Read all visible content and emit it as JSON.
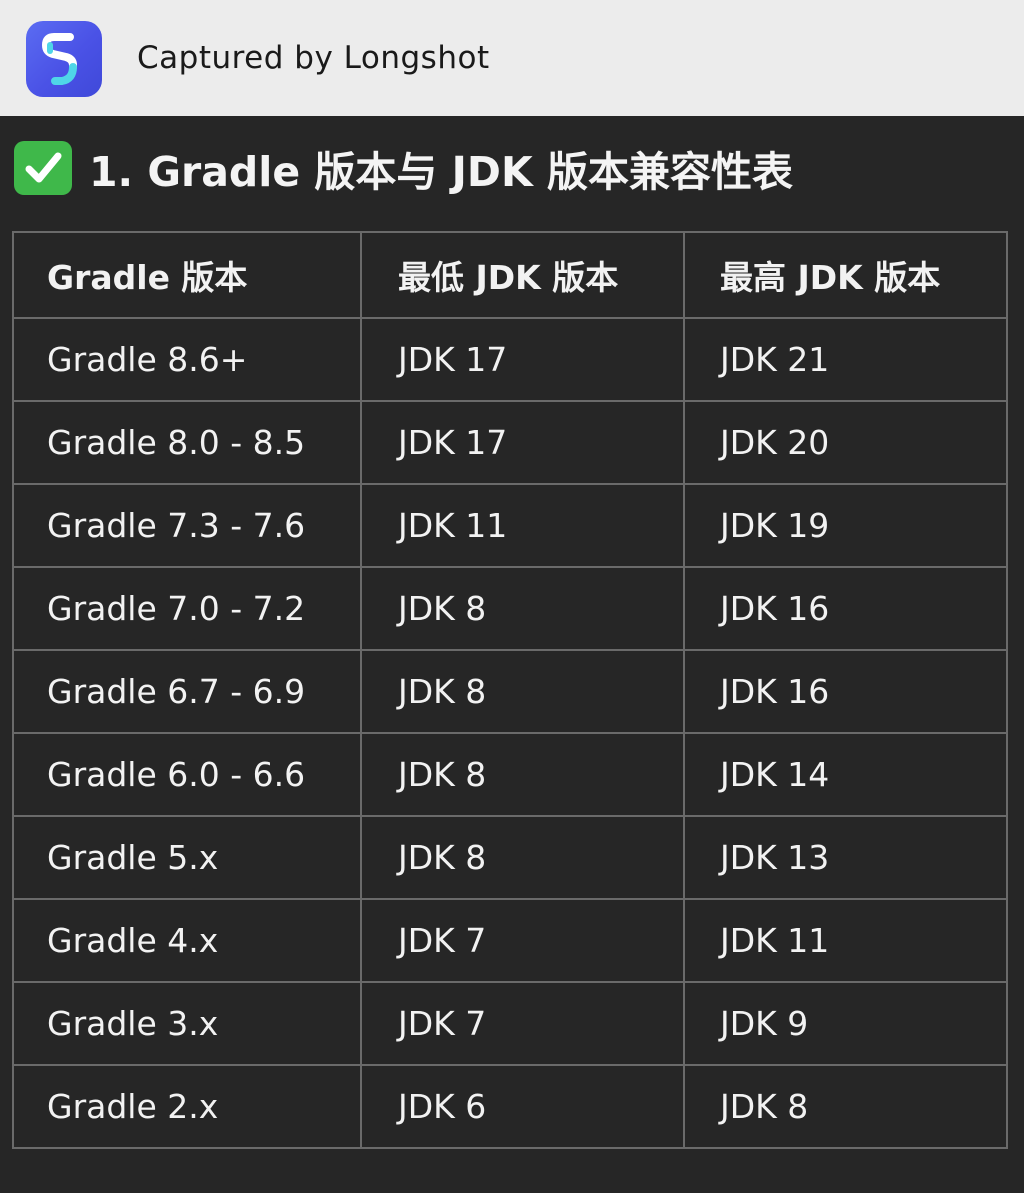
{
  "banner": {
    "app_icon": "longshot-s-icon",
    "text": "Captured by Longshot"
  },
  "heading": {
    "icon": "check-mark-button-icon",
    "text": "1. Gradle 版本与 JDK 版本兼容性表"
  },
  "table": {
    "headers": [
      "Gradle 版本",
      "最低 JDK 版本",
      "最高 JDK 版本"
    ],
    "rows": [
      [
        "Gradle 8.6+",
        "JDK 17",
        "JDK 21"
      ],
      [
        "Gradle 8.0 - 8.5",
        "JDK 17",
        "JDK 20"
      ],
      [
        "Gradle 7.3 - 7.6",
        "JDK 11",
        "JDK 19"
      ],
      [
        "Gradle 7.0 - 7.2",
        "JDK 8",
        "JDK 16"
      ],
      [
        "Gradle 6.7 - 6.9",
        "JDK 8",
        "JDK 16"
      ],
      [
        "Gradle 6.0 - 6.6",
        "JDK 8",
        "JDK 14"
      ],
      [
        "Gradle 5.x",
        "JDK 8",
        "JDK 13"
      ],
      [
        "Gradle 4.x",
        "JDK 7",
        "JDK 11"
      ],
      [
        "Gradle 3.x",
        "JDK 7",
        "JDK 9"
      ],
      [
        "Gradle 2.x",
        "JDK 6",
        "JDK 8"
      ]
    ]
  },
  "colors": {
    "background": "#262626",
    "banner": "#ececec",
    "app_icon": "#4a52e6",
    "check": "#3fb84a",
    "text": "#f2f2f2",
    "grid": "#6a6a6a"
  }
}
